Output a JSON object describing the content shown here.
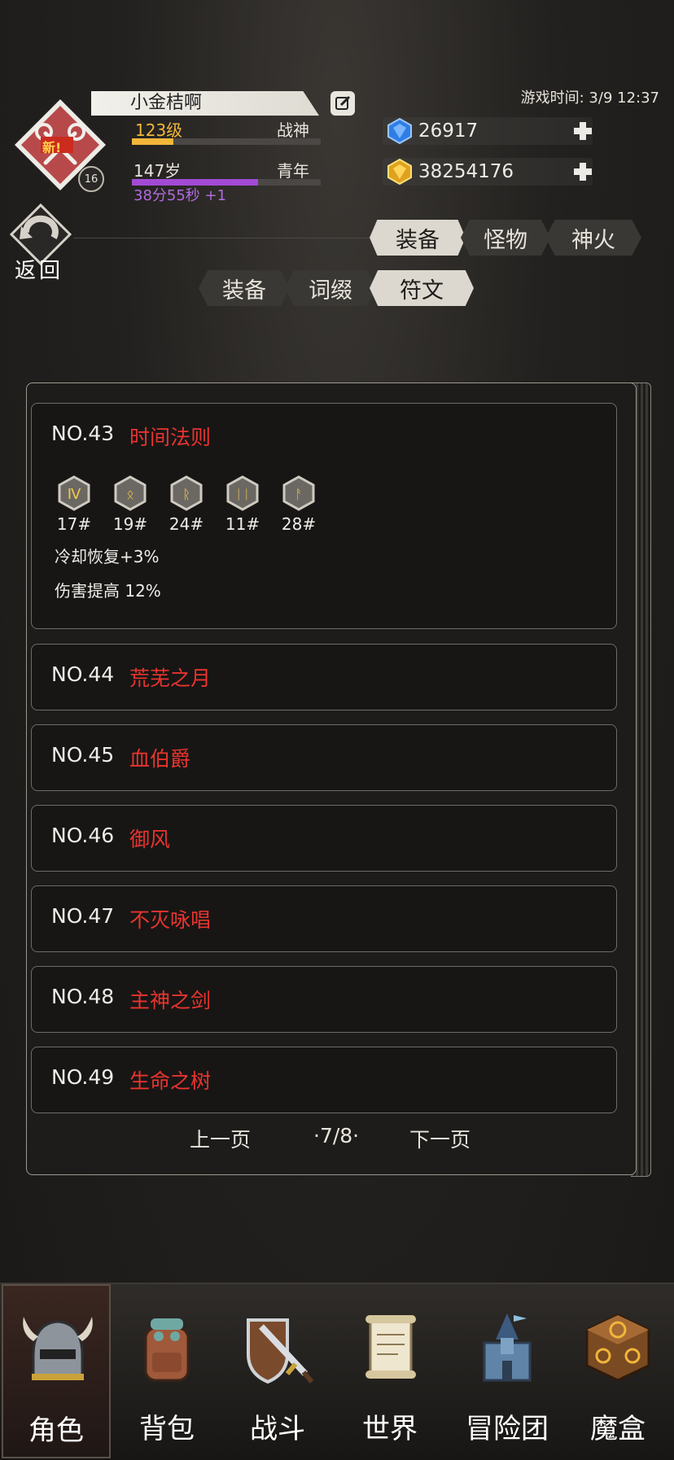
{
  "player": {
    "name": "小金桔啊",
    "level": "123级",
    "title": "战神",
    "level_progress": 0.22,
    "age": "147岁",
    "age_stage": "青年",
    "age_progress": 0.67,
    "time_left": "38分55秒 +1",
    "badge_level": "16",
    "avatar_tag": "新!"
  },
  "game_time": "游戏时间: 3/9 12:37",
  "currency": {
    "diamond": "26917",
    "gold": "38254176"
  },
  "back": {
    "label": "返回"
  },
  "top_tabs": [
    {
      "label": "装备",
      "active": true
    },
    {
      "label": "怪物",
      "active": false
    },
    {
      "label": "神火",
      "active": false
    }
  ],
  "sub_tabs": [
    {
      "label": "装备",
      "active": false
    },
    {
      "label": "词缀",
      "active": false
    },
    {
      "label": "符文",
      "active": true
    }
  ],
  "runewords": [
    {
      "no": "NO.43",
      "name": "时间法则",
      "expanded": true,
      "runes": [
        "17#",
        "19#",
        "24#",
        "11#",
        "28#"
      ],
      "effects": [
        "冷却恢复+3%",
        "伤害提高 12%"
      ]
    },
    {
      "no": "NO.44",
      "name": "荒芜之月"
    },
    {
      "no": "NO.45",
      "name": "血伯爵"
    },
    {
      "no": "NO.46",
      "name": "御风"
    },
    {
      "no": "NO.47",
      "name": "不灭咏唱"
    },
    {
      "no": "NO.48",
      "name": "主神之剑"
    },
    {
      "no": "NO.49",
      "name": "生命之树"
    }
  ],
  "pagination": {
    "prev": "上一页",
    "page": "·7/8·",
    "next": "下一页"
  },
  "nav": [
    {
      "label": "角色",
      "icon": "helmet-icon",
      "active": true
    },
    {
      "label": "背包",
      "icon": "backpack-icon",
      "active": false
    },
    {
      "label": "战斗",
      "icon": "sword-shield-icon",
      "active": false
    },
    {
      "label": "世界",
      "icon": "scroll-map-icon",
      "active": false
    },
    {
      "label": "冒险团",
      "icon": "castle-icon",
      "active": false
    },
    {
      "label": "魔盒",
      "icon": "magic-box-icon",
      "active": false
    }
  ],
  "colors": {
    "accent_red": "#e8342e",
    "level_gold": "#f2b63a",
    "age_purple": "#b06be0"
  }
}
